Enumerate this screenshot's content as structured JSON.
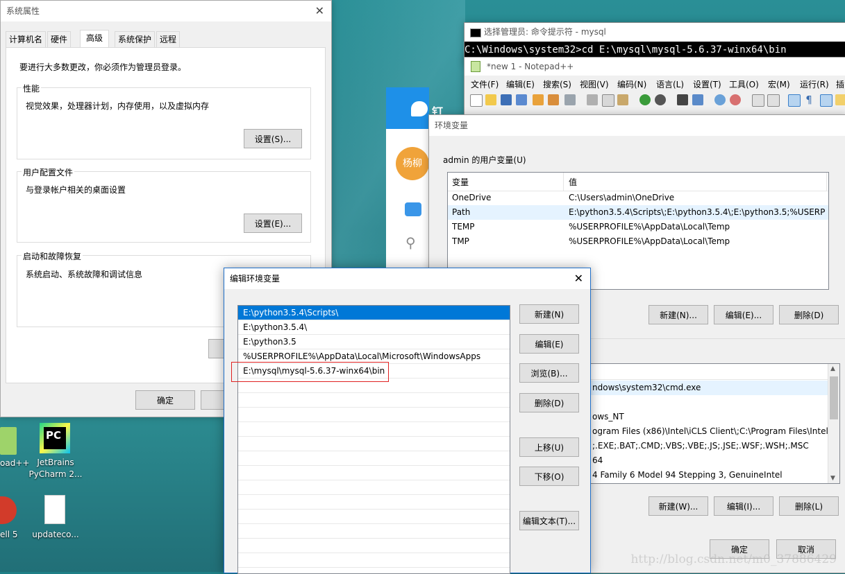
{
  "system_properties": {
    "title": "系统属性",
    "tabs": [
      "计算机名",
      "硬件",
      "高级",
      "系统保护",
      "远程"
    ],
    "active_tab": "高级",
    "notice": "要进行大多数更改，你必须作为管理员登录。",
    "performance": {
      "label": "性能",
      "desc": "视觉效果，处理器计划，内存使用，以及虚拟内存",
      "button": "设置(S)..."
    },
    "user_profiles": {
      "label": "用户配置文件",
      "desc": "与登录帐户相关的桌面设置",
      "button": "设置(E)..."
    },
    "startup": {
      "label": "启动和故障恢复",
      "desc": "系统启动、系统故障和调试信息"
    },
    "ok_button": "确定"
  },
  "cmd": {
    "title": "选择管理员: 命令提示符 - mysql",
    "line": "C:\\Windows\\system32>cd E:\\mysql\\mysql-5.6.37-winx64\\bin"
  },
  "notepad": {
    "title": "*new 1 - Notepad++",
    "menu": [
      "文件(F)",
      "编辑(E)",
      "搜索(S)",
      "视图(V)",
      "编码(N)",
      "语言(L)",
      "设置(T)",
      "工具(O)",
      "宏(M)",
      "运行(R)",
      "插"
    ]
  },
  "dingtalk": {
    "brand": "钉钉",
    "avatar": "杨柳"
  },
  "env_vars": {
    "title": "环境变量",
    "user_group_label": "admin 的用户变量(U)",
    "columns": [
      "变量",
      "值"
    ],
    "user_vars": [
      {
        "name": "OneDrive",
        "value": "C:\\Users\\admin\\OneDrive"
      },
      {
        "name": "Path",
        "value": "E:\\python3.5.4\\Scripts\\;E:\\python3.5.4\\;E:\\python3.5;%USERPR..."
      },
      {
        "name": "TEMP",
        "value": "%USERPROFILE%\\AppData\\Local\\Temp"
      },
      {
        "name": "TMP",
        "value": "%USERPROFILE%\\AppData\\Local\\Temp"
      }
    ],
    "user_buttons": [
      "新建(N)...",
      "编辑(E)...",
      "删除(D)"
    ],
    "system_vars_partial": [
      "ndows\\system32\\cmd.exe",
      "",
      "ows_NT",
      "ogram Files (x86)\\Intel\\iCLS Client\\;C:\\Program Files\\Intel...",
      ";.EXE;.BAT;.CMD;.VBS;.VBE;.JS;.JSE;.WSF;.WSH;.MSC",
      "64",
      "4 Family 6 Model 94 Stepping 3, GenuineIntel"
    ],
    "system_buttons": [
      "新建(W)...",
      "编辑(I)...",
      "删除(L)"
    ],
    "ok_button": "确定",
    "cancel_button": "取消"
  },
  "edit_env": {
    "title": "编辑环境变量",
    "paths": [
      "E:\\python3.5.4\\Scripts\\",
      "E:\\python3.5.4\\",
      "E:\\python3.5",
      "%USERPROFILE%\\AppData\\Local\\Microsoft\\WindowsApps",
      "E:\\mysql\\mysql-5.6.37-winx64\\bin"
    ],
    "selected_index": 0,
    "buttons": {
      "new": "新建(N)",
      "edit": "编辑(E)",
      "browse": "浏览(B)...",
      "delete": "删除(D)",
      "up": "上移(U)",
      "down": "下移(O)",
      "edit_text": "编辑文本(T)..."
    }
  },
  "desktop": {
    "icons": [
      {
        "label": "oad++"
      },
      {
        "label": "JetBrains PyCharm 2..."
      },
      {
        "label": "ell 5"
      },
      {
        "label": "updateco..."
      }
    ]
  },
  "watermark": "http://blog.csdn.net/m0_37886429"
}
